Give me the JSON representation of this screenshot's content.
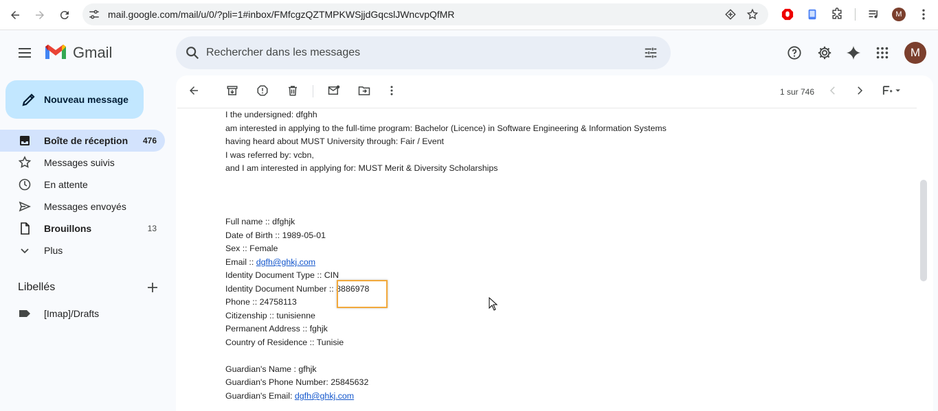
{
  "browser": {
    "url": "mail.google.com/mail/u/0/?pli=1#inbox/FMfcgzQZTMPKWSjjdGqcslJWncvpQfMR",
    "profile_initial": "M"
  },
  "header": {
    "app_name": "Gmail",
    "search_placeholder": "Rechercher dans les messages",
    "avatar_initial": "M"
  },
  "sidebar": {
    "compose_label": "Nouveau message",
    "items": [
      {
        "label": "Boîte de réception",
        "count": "476"
      },
      {
        "label": "Messages suivis",
        "count": ""
      },
      {
        "label": "En attente",
        "count": ""
      },
      {
        "label": "Messages envoyés",
        "count": ""
      },
      {
        "label": "Brouillons",
        "count": "13"
      },
      {
        "label": "Plus",
        "count": ""
      }
    ],
    "labels_title": "Libellés",
    "labels": [
      {
        "label": "[Imap]/Drafts"
      }
    ]
  },
  "toolbar": {
    "pager": "1 sur 746"
  },
  "email": {
    "lines": [
      "I the undersigned: dfghh",
      "am interested in applying to the full-time program: Bachelor (Licence) in Software Engineering & Information Systems",
      "having heard about MUST University through: Fair / Event",
      "I was referred by: vcbn,",
      "and I am interested in applying for: MUST Merit & Diversity Scholarships"
    ],
    "details": {
      "full_name": "Full name :: dfghjk",
      "dob": "Date of Birth :: 1989-05-01",
      "sex": "Sex :: Female",
      "email_label": "Email :: ",
      "email_value": "dgfh@ghkj.com",
      "id_type": "Identity Document Type :: CIN",
      "id_number_label": "Identity Document Number :: ",
      "id_number_value": "8886978",
      "phone": "Phone :: 24758113",
      "citizenship": "Citizenship :: tunisienne",
      "address": "Permanent Address :: fghjk",
      "country": "Country of Residence :: Tunisie",
      "guardian_name": "Guardian's Name : gfhjk",
      "guardian_phone": "Guardian's Phone Number: 25845632",
      "guardian_email_label": "Guardian's Email: ",
      "guardian_email_value": "dgfh@ghkj.com"
    }
  },
  "colors": {
    "compose_bg": "#c2e7ff",
    "active_item_bg": "#d3e3fd",
    "highlight_border": "#f2a93b",
    "link": "#1155cc"
  }
}
